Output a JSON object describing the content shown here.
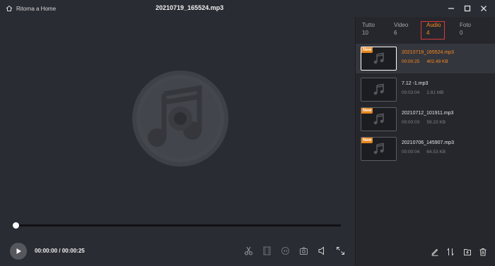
{
  "header": {
    "back_label": "Ritorna a Home",
    "title": "20210719_165524.mp3"
  },
  "player": {
    "time": "00:00:00 / 00:00:25",
    "progress": 0
  },
  "tabs": [
    {
      "label": "Tutto",
      "count": "10",
      "active": false
    },
    {
      "label": "Video",
      "count": "6",
      "active": false
    },
    {
      "label": "Audio",
      "count": "4",
      "active": true
    },
    {
      "label": "Foto",
      "count": "0",
      "active": false
    }
  ],
  "files": [
    {
      "name": "20210719_165524.mp3",
      "duration": "00:00:25",
      "size": "402.49 KB",
      "new": true,
      "selected": true
    },
    {
      "name": "7.12 -1.mp3",
      "duration": "00:03:04",
      "size": "2.81 MB",
      "new": false,
      "selected": false
    },
    {
      "name": "20210712_101911.mp3",
      "duration": "00:00:03",
      "size": "59.23 KB",
      "new": true,
      "selected": false
    },
    {
      "name": "20210706_145907.mp3",
      "duration": "00:00:04",
      "size": "64.53 KB",
      "new": true,
      "selected": false
    }
  ],
  "badge_text": "New",
  "colors": {
    "accent": "#ff8a1e",
    "background": "#2a2c33",
    "panel": "#25272d",
    "tab_highlight_box": "#d83a3a"
  },
  "icons": {
    "back": "home-back-icon",
    "minimize": "minimize-icon",
    "maximize": "maximize-icon",
    "close": "close-icon",
    "play": "play-icon",
    "player_controls": [
      "cut-icon",
      "film-icon",
      "speed-icon",
      "snapshot-icon",
      "volume-icon",
      "fullscreen-icon"
    ],
    "panel_actions": [
      "rename-icon",
      "sort-icon",
      "export-icon",
      "delete-icon"
    ]
  }
}
